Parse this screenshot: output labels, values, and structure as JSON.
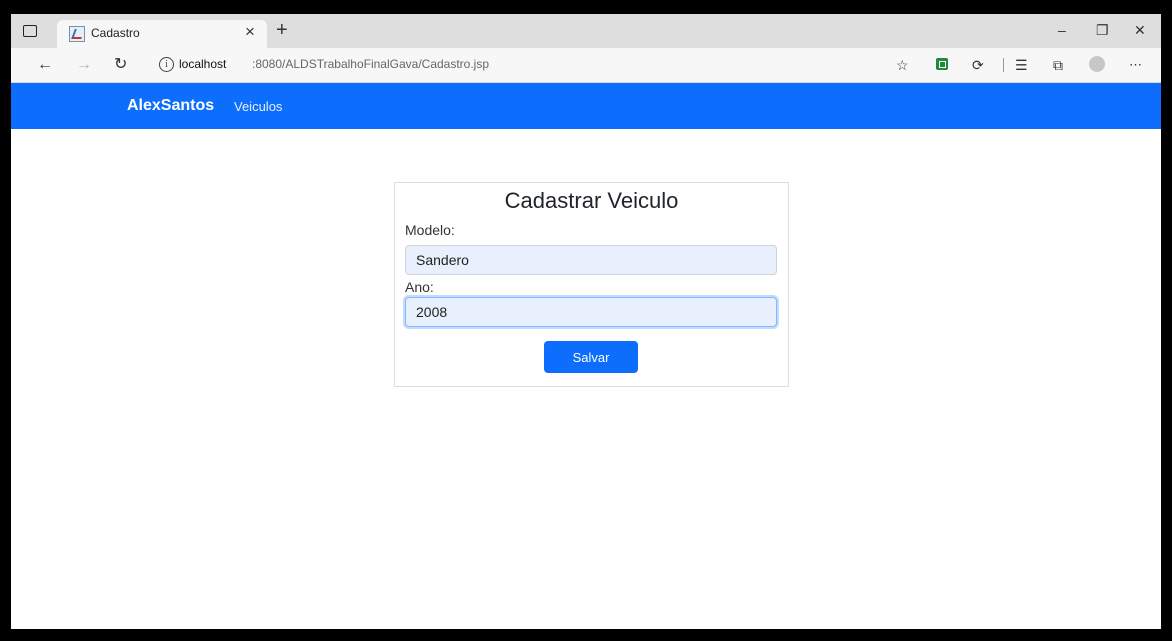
{
  "browser": {
    "tab_title": "Cadastro",
    "tab_close": "×",
    "new_tab": "+",
    "window_controls": {
      "minimize": "–",
      "restore": "❐",
      "close": "✕"
    },
    "address": {
      "host": "localhost",
      "path": ":8080/ALDSTrabalhoFinalGava/Cadastro.jsp"
    },
    "toolbar_icons": [
      "back-arrow-icon",
      "forward-arrow-icon",
      "refresh-icon",
      "info-icon",
      "favorite-add-icon",
      "extension-icon",
      "puzzle-icon",
      "favorites-list-icon",
      "collections-icon",
      "profile-icon",
      "more-icon"
    ]
  },
  "navbar": {
    "brand": "AlexSantos",
    "link": "Veiculos",
    "color": "#0d6efd"
  },
  "form": {
    "title": "Cadastrar Veiculo",
    "modelo_label": "Modelo:",
    "modelo_value": "Sandero",
    "ano_label": "Ano:",
    "ano_value": "2008",
    "submit_label": "Salvar"
  }
}
